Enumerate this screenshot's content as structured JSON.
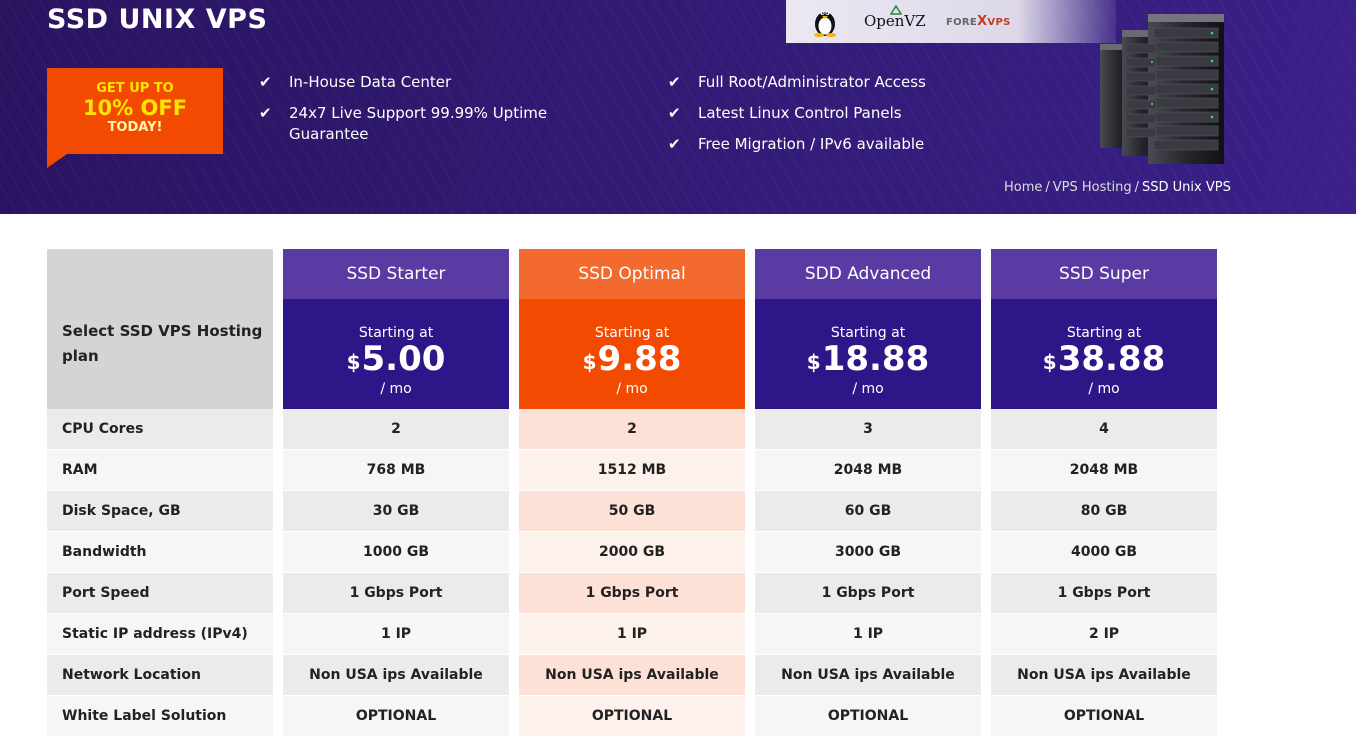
{
  "hero": {
    "title": "SSD UNIX VPS",
    "promo": {
      "line1": "GET UP TO",
      "line2": "10% OFF",
      "line3": "TODAY!"
    },
    "features_left": [
      "In-House Data Center",
      "24x7 Live Support 99.99% Uptime Guarantee"
    ],
    "features_right": [
      "Full Root/Administrator Access",
      "Latest Linux Control Panels",
      "Free Migration / IPv6 available"
    ],
    "os_logos": {
      "openvz": "OpenVZ",
      "forex_a": "FORE",
      "forex_x": "X",
      "forex_b": "VPS"
    },
    "icons": {
      "feature": "checkmark-icon",
      "linux": "tux-penguin-icon",
      "servers": "server-rack-illustration"
    }
  },
  "breadcrumb": {
    "home": "Home",
    "sep": "/",
    "section": "VPS Hosting",
    "current": "SSD Unix VPS"
  },
  "table": {
    "header_label": "Select SSD VPS Hosting plan",
    "row_labels": [
      "CPU Cores",
      "RAM",
      "Disk Space, GB",
      "Bandwidth",
      "Port Speed",
      "Static IP address (IPv4)",
      "Network Location",
      "White Label Solution"
    ],
    "plans": [
      {
        "name": "SSD Starter",
        "starting": "Starting at",
        "currency": "$",
        "price": "5.00",
        "period": "/ mo",
        "values": [
          "2",
          "768 MB",
          "30 GB",
          "1000 GB",
          "1 Gbps Port",
          "1 IP",
          "Non USA ips Available",
          "OPTIONAL"
        ]
      },
      {
        "name": "SSD Optimal",
        "starting": "Starting at",
        "currency": "$",
        "price": "9.88",
        "period": "/ mo",
        "values": [
          "2",
          "1512 MB",
          "50 GB",
          "2000 GB",
          "1 Gbps Port",
          "1 IP",
          "Non USA ips Available",
          "OPTIONAL"
        ]
      },
      {
        "name": "SDD Advanced",
        "starting": "Starting at",
        "currency": "$",
        "price": "18.88",
        "period": "/ mo",
        "values": [
          "3",
          "2048 MB",
          "60 GB",
          "3000 GB",
          "1 Gbps Port",
          "1 IP",
          "Non USA ips Available",
          "OPTIONAL"
        ]
      },
      {
        "name": "SSD Super",
        "starting": "Starting at",
        "currency": "$",
        "price": "38.88",
        "period": "/ mo",
        "values": [
          "4",
          "2048 MB",
          "80 GB",
          "4000 GB",
          "1 Gbps Port",
          "2 IP",
          "Non USA ips Available",
          "OPTIONAL"
        ]
      }
    ]
  },
  "colors": {
    "hero_bg": "#2f1870",
    "promo": "#f24a00",
    "plan_header": "#5a3ba3",
    "plan_price": "#2f1688",
    "highlight": "#f24a00"
  }
}
